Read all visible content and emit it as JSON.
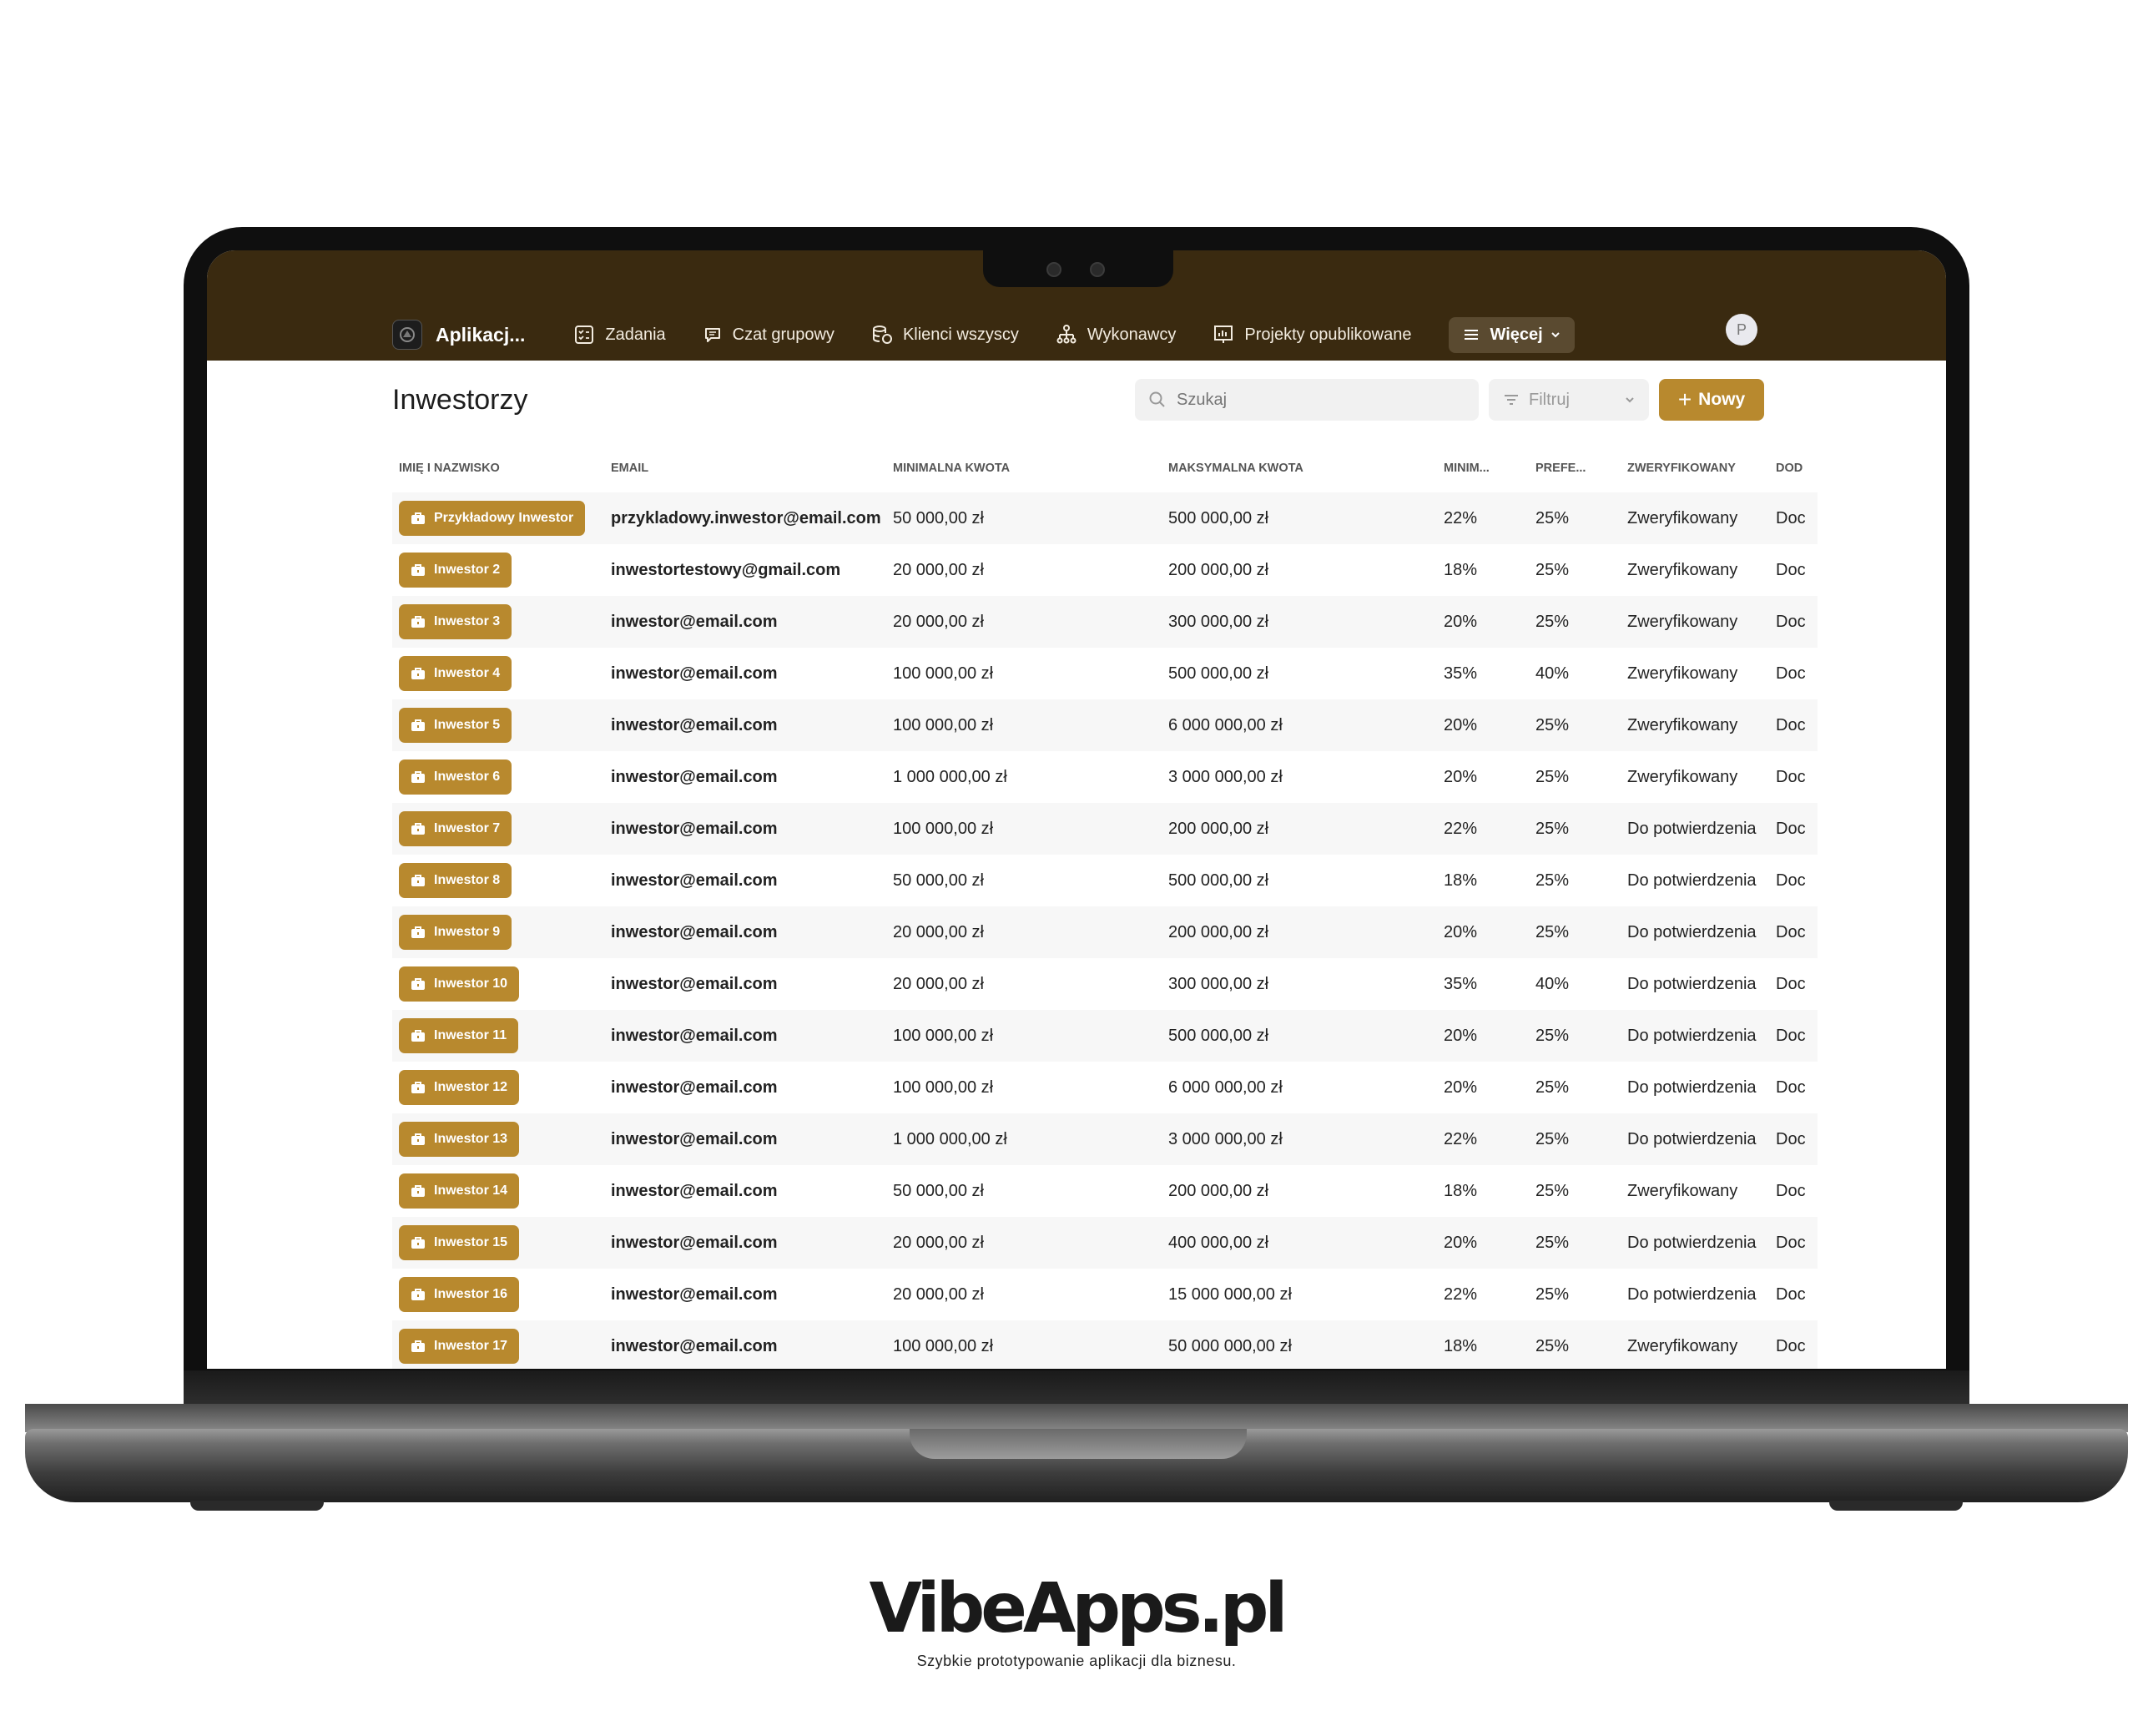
{
  "nav": {
    "app_name": "Aplikacj...",
    "items": [
      "Zadania",
      "Czat grupowy",
      "Klienci wszyscy",
      "Wykonawcy",
      "Projekty opublikowane"
    ],
    "more": "Więcej",
    "avatar": "P"
  },
  "page": {
    "title": "Inwestorzy",
    "search_placeholder": "Szukaj",
    "filter_label": "Filtruj",
    "new_label": "Nowy"
  },
  "table": {
    "columns": [
      "IMIĘ I NAZWISKO",
      "EMAIL",
      "MINIMALNA KWOTA",
      "MAKSYMALNA KWOTA",
      "MINIM...",
      "PREFE...",
      "ZWERYFIKOWANY",
      "DOD"
    ],
    "rows": [
      [
        "Przykładowy Inwestor",
        "przykladowy.inwestor@email.com",
        "50 000,00 zł",
        "500 000,00 zł",
        "22%",
        "25%",
        "Zweryfikowany",
        "Doc"
      ],
      [
        "Inwestor 2",
        "inwestortestowy@gmail.com",
        "20 000,00 zł",
        "200 000,00 zł",
        "18%",
        "25%",
        "Zweryfikowany",
        "Doc"
      ],
      [
        "Inwestor 3",
        "inwestor@email.com",
        "20 000,00 zł",
        "300 000,00 zł",
        "20%",
        "25%",
        "Zweryfikowany",
        "Doc"
      ],
      [
        "Inwestor 4",
        "inwestor@email.com",
        "100 000,00 zł",
        "500 000,00 zł",
        "35%",
        "40%",
        "Zweryfikowany",
        "Doc"
      ],
      [
        "Inwestor 5",
        "inwestor@email.com",
        "100 000,00 zł",
        "6 000 000,00 zł",
        "20%",
        "25%",
        "Zweryfikowany",
        "Doc"
      ],
      [
        "Inwestor 6",
        "inwestor@email.com",
        "1 000 000,00 zł",
        "3 000 000,00 zł",
        "20%",
        "25%",
        "Zweryfikowany",
        "Doc"
      ],
      [
        "Inwestor 7",
        "inwestor@email.com",
        "100 000,00 zł",
        "200 000,00 zł",
        "22%",
        "25%",
        "Do potwierdzenia",
        "Doc"
      ],
      [
        "Inwestor 8",
        "inwestor@email.com",
        "50 000,00 zł",
        "500 000,00 zł",
        "18%",
        "25%",
        "Do potwierdzenia",
        "Doc"
      ],
      [
        "Inwestor 9",
        "inwestor@email.com",
        "20 000,00 zł",
        "200 000,00 zł",
        "20%",
        "25%",
        "Do potwierdzenia",
        "Doc"
      ],
      [
        "Inwestor 10",
        "inwestor@email.com",
        "20 000,00 zł",
        "300 000,00 zł",
        "35%",
        "40%",
        "Do potwierdzenia",
        "Doc"
      ],
      [
        "Inwestor 11",
        "inwestor@email.com",
        "100 000,00 zł",
        "500 000,00 zł",
        "20%",
        "25%",
        "Do potwierdzenia",
        "Doc"
      ],
      [
        "Inwestor 12",
        "inwestor@email.com",
        "100 000,00 zł",
        "6 000 000,00 zł",
        "20%",
        "25%",
        "Do potwierdzenia",
        "Doc"
      ],
      [
        "Inwestor 13",
        "inwestor@email.com",
        "1 000 000,00 zł",
        "3 000 000,00 zł",
        "22%",
        "25%",
        "Do potwierdzenia",
        "Doc"
      ],
      [
        "Inwestor 14",
        "inwestor@email.com",
        "50 000,00 zł",
        "200 000,00 zł",
        "18%",
        "25%",
        "Zweryfikowany",
        "Doc"
      ],
      [
        "Inwestor 15",
        "inwestor@email.com",
        "20 000,00 zł",
        "400 000,00 zł",
        "20%",
        "25%",
        "Do potwierdzenia",
        "Doc"
      ],
      [
        "Inwestor 16",
        "inwestor@email.com",
        "20 000,00 zł",
        "15 000 000,00 zł",
        "22%",
        "25%",
        "Do potwierdzenia",
        "Doc"
      ],
      [
        "Inwestor 17",
        "inwestor@email.com",
        "100 000,00 zł",
        "50 000 000,00 zł",
        "18%",
        "25%",
        "Zweryfikowany",
        "Doc"
      ]
    ]
  },
  "brand": {
    "name": "VibeApps.pl",
    "tagline": "Szybkie prototypowanie aplikacji dla biznesu."
  },
  "colors": {
    "topbar": "#3a2a10",
    "accent": "#b8892e"
  }
}
